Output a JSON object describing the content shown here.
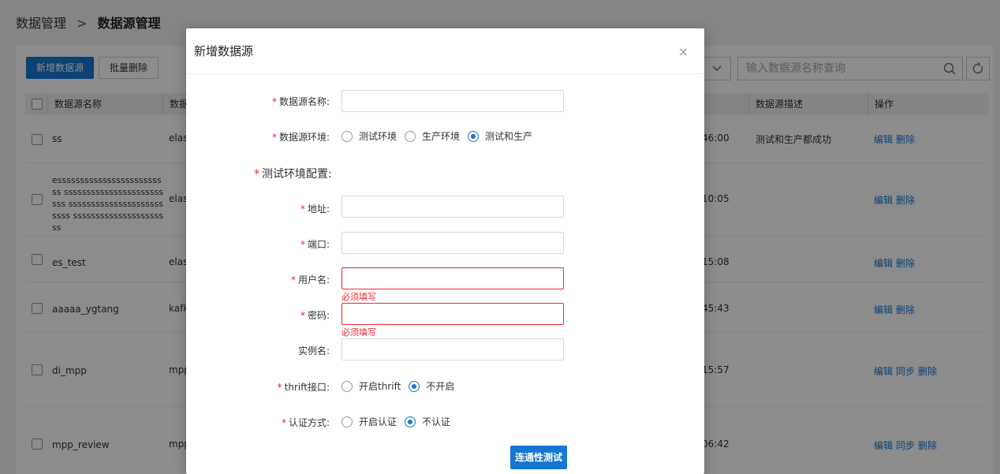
{
  "breadcrumb": {
    "parent": "数据管理",
    "separator": ">",
    "current": "数据源管理"
  },
  "toolbar": {
    "add_label": "新增数据源",
    "batch_delete_label": "批量删除",
    "search_placeholder": "输入数据源名称查询"
  },
  "table": {
    "headers": {
      "name": "数据源名称",
      "type": "数据",
      "description": "数据源描述",
      "ops": "操作"
    },
    "rows": [
      {
        "name": "ss",
        "type": "elas",
        "time": "46:00",
        "description": "测试和生产都成功",
        "ops": [
          "编辑",
          "删除"
        ]
      },
      {
        "name": "esssssssssssssssssssssssss sssssssssssssssssssssssss sssssssssssssssssssssssss ssssssssssssssssssssss",
        "type": "elas",
        "time": "10:05",
        "description": "",
        "ops": [
          "编辑",
          "删除"
        ]
      },
      {
        "name": "es_test",
        "type": "elas",
        "time": "15:08",
        "description": "",
        "ops": [
          "编辑",
          "删除"
        ]
      },
      {
        "name": "aaaaa_ygtang",
        "type": "kafk",
        "time": "45:43",
        "description": "",
        "ops": [
          "编辑",
          "删除"
        ]
      },
      {
        "name": "di_mpp",
        "type": "mpp",
        "time": "15:57",
        "description": "",
        "ops": [
          "编辑",
          "同步",
          "删除"
        ]
      },
      {
        "name": "mpp_review",
        "type": "mpp",
        "time": "06:42",
        "description": "",
        "ops": [
          "编辑",
          "同步",
          "删除"
        ]
      }
    ]
  },
  "modal": {
    "title": "新增数据源",
    "close": "×",
    "fields": {
      "name_label": "数据源名称:",
      "env_label": "数据源环境:",
      "env_options": [
        "测试环境",
        "生产环境",
        "测试和生产"
      ],
      "env_selected": "测试和生产",
      "section_title": "测试环境配置:",
      "address_label": "地址:",
      "port_label": "端口:",
      "username_label": "用户名:",
      "username_error": "必须填写",
      "password_label": "密码:",
      "password_error": "必须填写",
      "instance_label": "实例名:",
      "thrift_label": "thrift接口:",
      "thrift_options": [
        "开启thrift",
        "不开启"
      ],
      "thrift_selected": "不开启",
      "auth_label": "认证方式:",
      "auth_options": [
        "开启认证",
        "不认证"
      ],
      "auth_selected": "不认证"
    },
    "test_button": "连通性测试"
  },
  "colors": {
    "primary": "#1677d2",
    "error": "#f5222d",
    "overlay": "rgba(0,0,0,0.45)"
  }
}
